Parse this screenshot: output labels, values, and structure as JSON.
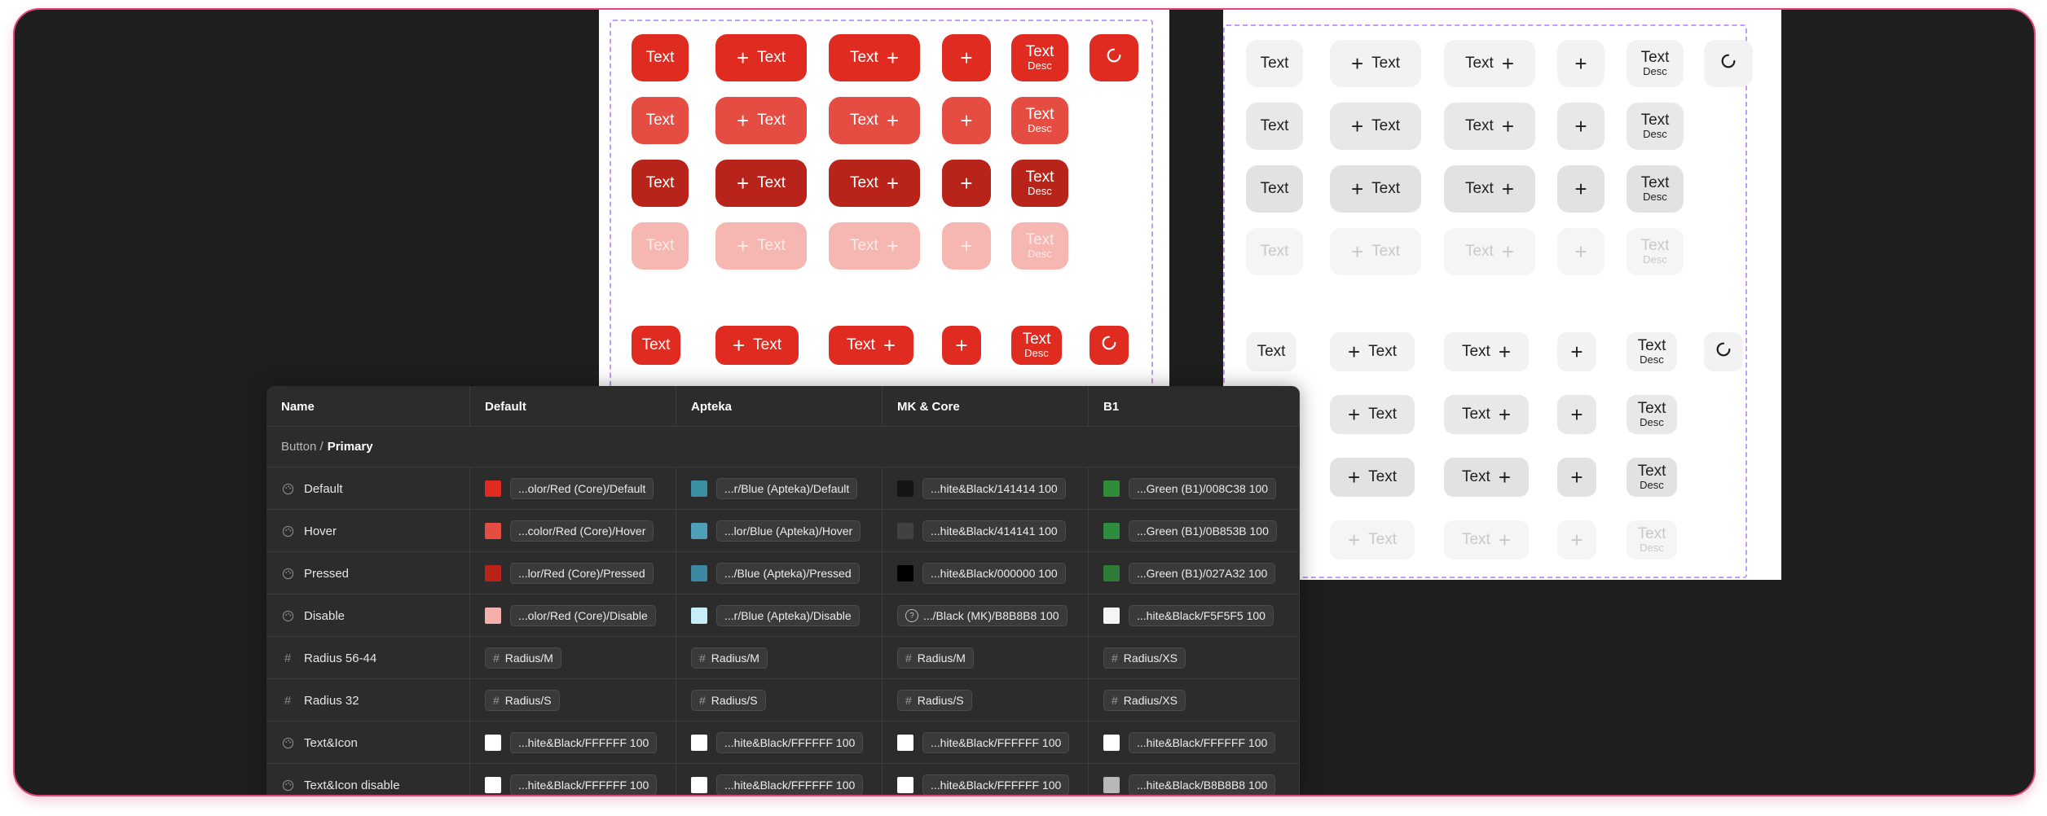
{
  "colors": {
    "red_default": "#e02b20",
    "red_hover": "#e64d42",
    "red_pressed": "#b8241a",
    "red_disable": "#f6b6b1",
    "gray_default": "#f2f2f2",
    "gray_hover": "#e8e8e8",
    "gray_pressed": "#e2e2e2",
    "gray_disable": "#f5f5f5",
    "frame_border": "#e0457b",
    "dashed_border": "#c49bf5"
  },
  "button": {
    "text": "Text",
    "desc": "Desc",
    "plus_icon": "plus-icon",
    "spinner_icon": "refresh-icon"
  },
  "table": {
    "headers": [
      "Name",
      "Default",
      "Apteka",
      "MK & Core",
      "B1"
    ],
    "group": {
      "prefix": "Button /",
      "name": "Primary"
    },
    "rows": [
      {
        "name": "Default",
        "icon": "palette-icon",
        "kind": "color",
        "cells": [
          {
            "swatch": "#e02b20",
            "value": "...olor/Red (Core)/Default"
          },
          {
            "swatch": "#3b8fa3",
            "value": "...r/Blue (Apteka)/Default"
          },
          {
            "swatch": "#141414",
            "value": "...hite&Black/141414 100"
          },
          {
            "swatch": "#2f8c38",
            "value": "...Green (B1)/008C38 100"
          }
        ]
      },
      {
        "name": "Hover",
        "icon": "palette-icon",
        "kind": "color",
        "cells": [
          {
            "swatch": "#e64d42",
            "value": "...color/Red (Core)/Hover"
          },
          {
            "swatch": "#4ea0b8",
            "value": "...lor/Blue (Apteka)/Hover"
          },
          {
            "swatch": "#414141",
            "value": "...hite&Black/414141 100"
          },
          {
            "swatch": "#2d8c3d",
            "value": "...Green (B1)/0B853B 100"
          }
        ]
      },
      {
        "name": "Pressed",
        "icon": "palette-icon",
        "kind": "color",
        "cells": [
          {
            "swatch": "#b8241a",
            "value": "...lor/Red (Core)/Pressed"
          },
          {
            "swatch": "#3b88a0",
            "value": ".../Blue (Apteka)/Pressed"
          },
          {
            "swatch": "#000000",
            "value": "...hite&Black/000000 100"
          },
          {
            "swatch": "#2f7a36",
            "value": "...Green (B1)/027A32 100"
          }
        ]
      },
      {
        "name": "Disable",
        "icon": "palette-icon",
        "kind": "color",
        "cells": [
          {
            "swatch": "#f6b0ab",
            "value": "...olor/Red (Core)/Disable"
          },
          {
            "swatch": "#c6eef7",
            "value": "...r/Blue (Apteka)/Disable"
          },
          {
            "swatch": "",
            "value": ".../Black (MK)/B8B8B8 100",
            "special": "component-icon"
          },
          {
            "swatch": "#f5f5f5",
            "value": "...hite&Black/F5F5F5 100"
          }
        ]
      },
      {
        "name": "Radius 56-44",
        "icon": "hash-icon",
        "kind": "token",
        "cells": [
          {
            "value": "Radius/M"
          },
          {
            "value": "Radius/M"
          },
          {
            "value": "Radius/M"
          },
          {
            "value": "Radius/XS"
          }
        ]
      },
      {
        "name": "Radius 32",
        "icon": "hash-icon",
        "kind": "token",
        "cells": [
          {
            "value": "Radius/S"
          },
          {
            "value": "Radius/S"
          },
          {
            "value": "Radius/S"
          },
          {
            "value": "Radius/XS"
          }
        ]
      },
      {
        "name": "Text&Icon",
        "icon": "palette-icon",
        "kind": "color",
        "cells": [
          {
            "swatch": "#ffffff",
            "value": "...hite&Black/FFFFFF 100"
          },
          {
            "swatch": "#ffffff",
            "value": "...hite&Black/FFFFFF 100"
          },
          {
            "swatch": "#ffffff",
            "value": "...hite&Black/FFFFFF 100"
          },
          {
            "swatch": "#ffffff",
            "value": "...hite&Black/FFFFFF 100"
          }
        ]
      },
      {
        "name": "Text&Icon disable",
        "icon": "palette-icon",
        "kind": "color",
        "cells": [
          {
            "swatch": "#ffffff",
            "value": "...hite&Black/FFFFFF 100"
          },
          {
            "swatch": "#ffffff",
            "value": "...hite&Black/FFFFFF 100"
          },
          {
            "swatch": "#ffffff",
            "value": "...hite&Black/FFFFFF 100"
          },
          {
            "swatch": "#b8b8b8",
            "value": "...hite&Black/B8B8B8 100"
          }
        ]
      }
    ]
  }
}
